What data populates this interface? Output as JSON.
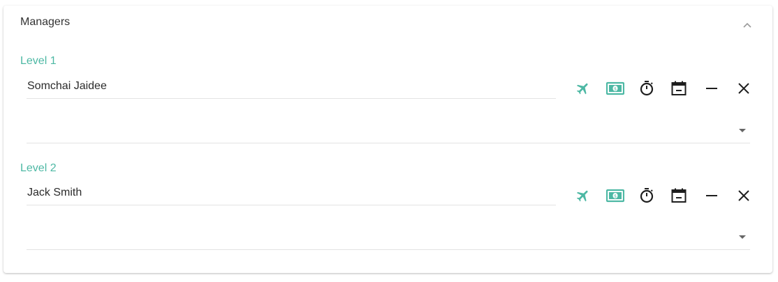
{
  "panel": {
    "title": "Managers",
    "levels": [
      {
        "label": "Level 1",
        "manager": "Somchai Jaidee",
        "select_value": ""
      },
      {
        "label": "Level 2",
        "manager": "Jack Smith",
        "select_value": ""
      }
    ]
  },
  "icons": {
    "collapse": "chevron-up-icon",
    "actions": [
      "airplane-icon",
      "cash-icon",
      "stopwatch-icon",
      "calendar-icon",
      "minus-icon",
      "close-icon"
    ]
  },
  "colors": {
    "accent": "#4db8a4",
    "icon_dark": "#1e1e1e",
    "divider": "#e3e3e3"
  }
}
